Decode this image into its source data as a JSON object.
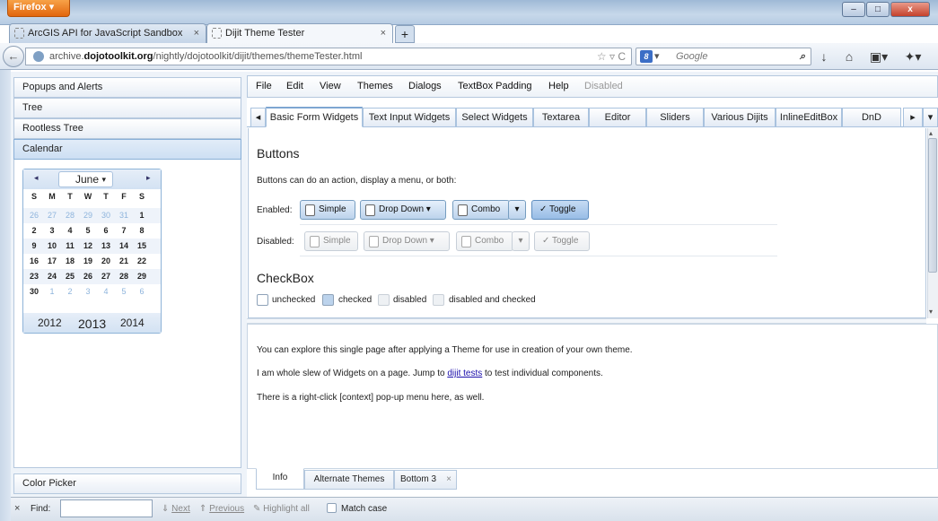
{
  "browser": {
    "menu_label": "Firefox ▾",
    "window_controls": [
      "–",
      "□",
      "x"
    ],
    "tabs": [
      {
        "title": "ArcGIS API for JavaScript Sandbox",
        "close": "×"
      },
      {
        "title": "Dijit Theme Tester",
        "close": "×"
      }
    ],
    "new_tab": "+",
    "back": "←",
    "url_prefix": "archive.",
    "url_host": "dojotoolkit.org",
    "url_path": "/nightly/dojotoolkit/dijit/themes/themeTester.html",
    "url_icons": "☆ ▿ C",
    "search_engine_letter": "8",
    "search_placeholder": "Google",
    "search_dropdown": "▾",
    "search_go": "⌕",
    "toolbar_icons": [
      "↓",
      "⌂",
      "▣▾",
      "✦▾"
    ]
  },
  "accordion": {
    "panes": [
      "Popups and Alerts",
      "Tree",
      "Rootless Tree",
      "Calendar"
    ],
    "bottom_pane": "Color Picker"
  },
  "calendar": {
    "month": "June",
    "prev": "◂",
    "next": "▸",
    "dropdown": "▾",
    "weekdays": [
      "S",
      "M",
      "T",
      "W",
      "T",
      "F",
      "S"
    ],
    "weeks": [
      [
        "26",
        "27",
        "28",
        "29",
        "30",
        "31",
        "1"
      ],
      [
        "2",
        "3",
        "4",
        "5",
        "6",
        "7",
        "8"
      ],
      [
        "9",
        "10",
        "11",
        "12",
        "13",
        "14",
        "15"
      ],
      [
        "16",
        "17",
        "18",
        "19",
        "20",
        "21",
        "22"
      ],
      [
        "23",
        "24",
        "25",
        "26",
        "27",
        "28",
        "29"
      ],
      [
        "30",
        "1",
        "2",
        "3",
        "4",
        "5",
        "6"
      ]
    ],
    "years": [
      "2012",
      "2013",
      "2014"
    ]
  },
  "menubar": [
    "File",
    "Edit",
    "View",
    "Themes",
    "Dialogs",
    "TextBox Padding",
    "Help",
    "Disabled"
  ],
  "widget_tabs": {
    "scroll_left": "◂",
    "scroll_right": "▸",
    "menu": "▾",
    "items": [
      "Basic Form Widgets",
      "Text Input Widgets",
      "Select Widgets",
      "Textarea",
      "Editor",
      "Sliders",
      "Various Dijits",
      "InlineEditBox",
      "DnD"
    ]
  },
  "buttons_section": {
    "heading": "Buttons",
    "description": "Buttons can do an action, display a menu, or both:",
    "enabled_label": "Enabled:",
    "disabled_label": "Disabled:",
    "simple": "Simple",
    "drop_down": "Drop Down ▾",
    "combo": "Combo",
    "combo_arrow": "▾",
    "toggle": "✓ Toggle"
  },
  "checkbox_section": {
    "heading": "CheckBox",
    "unchecked": "unchecked",
    "checked": "checked",
    "disabled": "disabled",
    "disabled_checked": "disabled and checked"
  },
  "scroll": {
    "up": "▴",
    "down": "▾"
  },
  "info": {
    "line1": "You can explore this single page after applying a Theme for use in creation of your own theme.",
    "line2_pre": "I am whole slew of Widgets on a page. Jump to ",
    "line2_link": "dijit tests",
    "line2_post": " to test individual components.",
    "line3": "There is a right-click [context] pop-up menu here, as well."
  },
  "bottom_tabs": [
    "Info",
    "Alternate Themes",
    "Bottom 3"
  ],
  "bottom_tab_close": "×",
  "findbar": {
    "close": "×",
    "label": "Find:",
    "next": "Next",
    "previous": "Previous",
    "highlight": "Highlight all",
    "match_case": "Match case",
    "next_icon": "⇓",
    "prev_icon": "⇑",
    "highlight_icon": "✎"
  }
}
